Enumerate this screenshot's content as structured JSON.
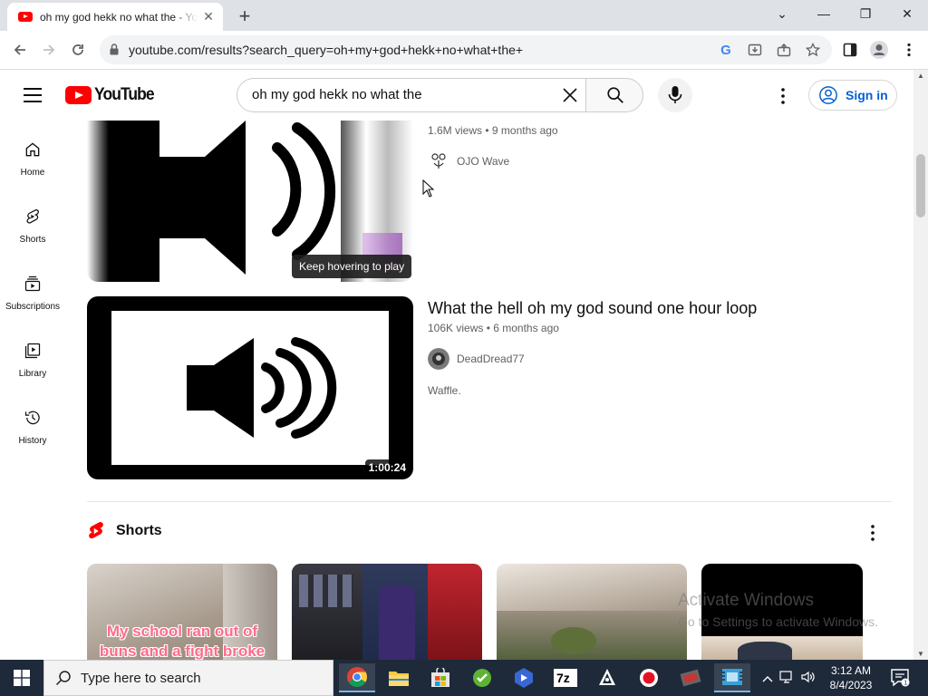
{
  "browser": {
    "tab_title": "oh my god hekk no what the - YouTube",
    "tab_close": "✕",
    "new_tab": "+",
    "window_buttons": [
      "⌄",
      "—",
      "❐",
      "✕"
    ],
    "url": "youtube.com/results?search_query=oh+my+god+hekk+no+what+the+"
  },
  "youtube": {
    "logo_text": "YouTube",
    "search_query": "oh my god hekk no what the",
    "signin_label": "Sign in",
    "guide": [
      {
        "label": "Home",
        "icon": "home-icon"
      },
      {
        "label": "Shorts",
        "icon": "shorts-icon"
      },
      {
        "label": "Subscriptions",
        "icon": "subscriptions-icon"
      },
      {
        "label": "Library",
        "icon": "library-icon"
      },
      {
        "label": "History",
        "icon": "history-icon"
      }
    ]
  },
  "results": [
    {
      "title": "",
      "meta": "1.6M views • 9 months ago",
      "channel": "OJO Wave",
      "tooltip": "Keep hovering to play"
    },
    {
      "title": "What the hell oh my god sound one hour loop",
      "meta": "106K views • 6 months ago",
      "channel": "DeadDread77",
      "description": "Waffle.",
      "duration": "1:00:24"
    }
  ],
  "shorts": {
    "heading": "Shorts",
    "items": [
      {
        "overlay": "My school ran out of buns and a fight broke"
      },
      {
        "overlay": ""
      },
      {
        "overlay": ""
      },
      {
        "overlay": ""
      }
    ]
  },
  "watermark": {
    "line1": "Activate Windows",
    "line2": "Go to Settings to activate Windows."
  },
  "taskbar": {
    "search_placeholder": "Type here to search",
    "time": "3:12 AM",
    "date": "8/4/2023",
    "apps": [
      "chrome-icon",
      "file-explorer-icon",
      "store-icon",
      "app-green-icon",
      "app-blue-icon",
      "7zip-icon",
      "inkscape-icon",
      "recorder-icon",
      "app-film-icon",
      "video-editor-icon"
    ]
  },
  "colors": {
    "youtube_red": "#ff0000",
    "link_blue": "#065fd4",
    "taskbar": "#1e2a3a"
  }
}
